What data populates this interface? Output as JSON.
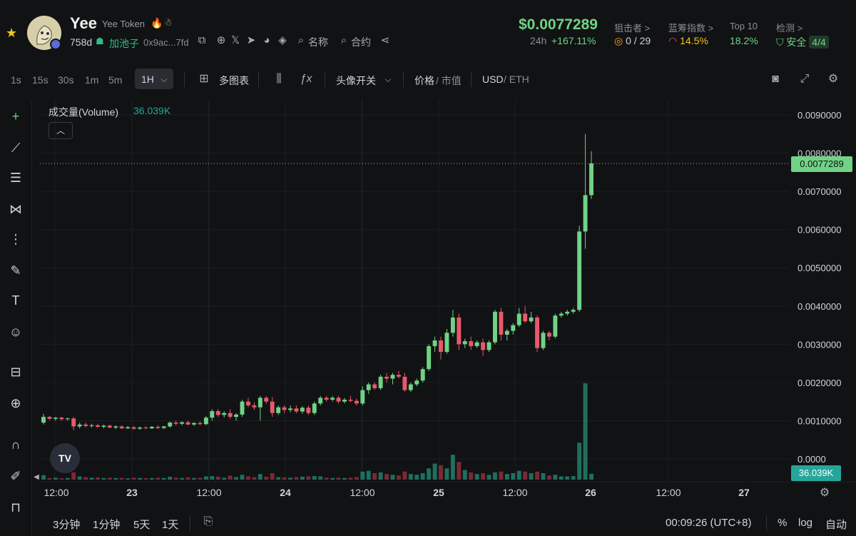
{
  "token": {
    "symbol": "Yee",
    "name": "Yee Token",
    "age": "758d",
    "pool_label": "加池子",
    "address": "0x9ac...7fd",
    "links": {
      "name": "名称",
      "contract": "合约"
    }
  },
  "market": {
    "price": "$0.0077289",
    "change_label": "24h",
    "change": "+167.11%"
  },
  "stats": [
    {
      "title": "狙击者 >",
      "value": "0 / 29",
      "color": "#d1d4dc"
    },
    {
      "title": "蓝筹指数 >",
      "value": "14.5%",
      "color": "#f5c518"
    },
    {
      "title": "Top 10",
      "value": "18.2%",
      "color": "#6fd385"
    },
    {
      "title": "检测 >",
      "value": "安全",
      "badge": "4/4",
      "color": "#6fd385"
    }
  ],
  "toolbar": {
    "timeframes": [
      "1s",
      "15s",
      "30s",
      "1m",
      "5m"
    ],
    "active_timeframe": "1H",
    "multi_chart": "多图表",
    "avatar_toggle": "头像开关",
    "price_label": "价格",
    "mcap_label": "市值",
    "usd_label": "USD",
    "eth_label": "ETH"
  },
  "legend": {
    "volume_label": "成交量(Volume)",
    "volume_value": "36.039K"
  },
  "tags": {
    "price": "0.0077289",
    "volume": "36.039K"
  },
  "bottom": {
    "ranges": [
      "3分钟",
      "1分钟",
      "5天",
      "1天"
    ],
    "clock": "00:09:26 (UTC+8)",
    "percent": "%",
    "log": "log",
    "auto": "自动"
  },
  "colors": {
    "up": "#6fd385",
    "down": "#e8596b",
    "vol_up": "#1f6f5e",
    "vol_down": "#7a2a35",
    "accent": "#6fd385"
  },
  "chart_data": {
    "type": "candlestick",
    "y_ticks": [
      "0.0090000",
      "0.0080000",
      "0.0070000",
      "0.0060000",
      "0.0050000",
      "0.0040000",
      "0.0030000",
      "0.0020000",
      "0.0010000",
      "0.0000"
    ],
    "ylim": [
      0,
      0.0095
    ],
    "x_ticks": [
      "12:00",
      "23",
      "12:00",
      "24",
      "12:00",
      "25",
      "12:00",
      "26",
      "12:00",
      "27"
    ],
    "last_price": 0.0077289,
    "volume_last": "36.039K",
    "series": [
      {
        "o": 0.00095,
        "h": 0.00118,
        "l": 0.0009,
        "c": 0.0011,
        "v": 0.28
      },
      {
        "o": 0.0011,
        "h": 0.00112,
        "l": 0.00102,
        "c": 0.00105,
        "v": 0.1
      },
      {
        "o": 0.00105,
        "h": 0.0011,
        "l": 0.001,
        "c": 0.00108,
        "v": 0.12
      },
      {
        "o": 0.00108,
        "h": 0.0011,
        "l": 0.001,
        "c": 0.00104,
        "v": 0.08
      },
      {
        "o": 0.00104,
        "h": 0.00108,
        "l": 0.001,
        "c": 0.00106,
        "v": 0.1
      },
      {
        "o": 0.00106,
        "h": 0.0011,
        "l": 0.00075,
        "c": 0.00085,
        "v": 0.45
      },
      {
        "o": 0.00085,
        "h": 0.00095,
        "l": 0.0008,
        "c": 0.0009,
        "v": 0.2
      },
      {
        "o": 0.0009,
        "h": 0.00095,
        "l": 0.00082,
        "c": 0.00086,
        "v": 0.15
      },
      {
        "o": 0.00086,
        "h": 0.00092,
        "l": 0.00082,
        "c": 0.00088,
        "v": 0.12
      },
      {
        "o": 0.00088,
        "h": 0.00092,
        "l": 0.00082,
        "c": 0.00084,
        "v": 0.14
      },
      {
        "o": 0.00084,
        "h": 0.0009,
        "l": 0.0008,
        "c": 0.00087,
        "v": 0.1
      },
      {
        "o": 0.00087,
        "h": 0.0009,
        "l": 0.0008,
        "c": 0.00082,
        "v": 0.12
      },
      {
        "o": 0.00082,
        "h": 0.00088,
        "l": 0.00078,
        "c": 0.00085,
        "v": 0.1
      },
      {
        "o": 0.00085,
        "h": 0.00088,
        "l": 0.00078,
        "c": 0.0008,
        "v": 0.11
      },
      {
        "o": 0.0008,
        "h": 0.00086,
        "l": 0.00078,
        "c": 0.00083,
        "v": 0.08
      },
      {
        "o": 0.00083,
        "h": 0.00086,
        "l": 0.00076,
        "c": 0.00079,
        "v": 0.12
      },
      {
        "o": 0.00079,
        "h": 0.00085,
        "l": 0.00076,
        "c": 0.00082,
        "v": 0.1
      },
      {
        "o": 0.00082,
        "h": 0.00086,
        "l": 0.00078,
        "c": 0.0008,
        "v": 0.09
      },
      {
        "o": 0.0008,
        "h": 0.00086,
        "l": 0.00078,
        "c": 0.00084,
        "v": 0.1
      },
      {
        "o": 0.00084,
        "h": 0.00088,
        "l": 0.00078,
        "c": 0.00081,
        "v": 0.12
      },
      {
        "o": 0.00081,
        "h": 0.00086,
        "l": 0.00078,
        "c": 0.00085,
        "v": 0.1
      },
      {
        "o": 0.00085,
        "h": 0.00098,
        "l": 0.00082,
        "c": 0.00095,
        "v": 0.18
      },
      {
        "o": 0.00095,
        "h": 0.001,
        "l": 0.00088,
        "c": 0.00092,
        "v": 0.12
      },
      {
        "o": 0.00092,
        "h": 0.00098,
        "l": 0.00088,
        "c": 0.00096,
        "v": 0.1
      },
      {
        "o": 0.00096,
        "h": 0.001,
        "l": 0.00088,
        "c": 0.0009,
        "v": 0.14
      },
      {
        "o": 0.0009,
        "h": 0.00096,
        "l": 0.00086,
        "c": 0.00094,
        "v": 0.1
      },
      {
        "o": 0.00094,
        "h": 0.00098,
        "l": 0.00088,
        "c": 0.00091,
        "v": 0.11
      },
      {
        "o": 0.00091,
        "h": 0.00112,
        "l": 0.00088,
        "c": 0.00108,
        "v": 0.2
      },
      {
        "o": 0.00108,
        "h": 0.0013,
        "l": 0.001,
        "c": 0.00125,
        "v": 0.22
      },
      {
        "o": 0.00125,
        "h": 0.0013,
        "l": 0.0011,
        "c": 0.00115,
        "v": 0.18
      },
      {
        "o": 0.00115,
        "h": 0.00125,
        "l": 0.00108,
        "c": 0.0012,
        "v": 0.12
      },
      {
        "o": 0.0012,
        "h": 0.0013,
        "l": 0.00105,
        "c": 0.0011,
        "v": 0.25
      },
      {
        "o": 0.0011,
        "h": 0.0012,
        "l": 0.001,
        "c": 0.00116,
        "v": 0.16
      },
      {
        "o": 0.00116,
        "h": 0.00155,
        "l": 0.0011,
        "c": 0.0015,
        "v": 0.3
      },
      {
        "o": 0.0015,
        "h": 0.0016,
        "l": 0.00135,
        "c": 0.0014,
        "v": 0.2
      },
      {
        "o": 0.0014,
        "h": 0.00148,
        "l": 0.00128,
        "c": 0.00135,
        "v": 0.15
      },
      {
        "o": 0.00135,
        "h": 0.00165,
        "l": 0.001,
        "c": 0.0016,
        "v": 0.35
      },
      {
        "o": 0.0016,
        "h": 0.00165,
        "l": 0.00145,
        "c": 0.0015,
        "v": 0.18
      },
      {
        "o": 0.0015,
        "h": 0.00162,
        "l": 0.0011,
        "c": 0.0012,
        "v": 0.4
      },
      {
        "o": 0.0012,
        "h": 0.0014,
        "l": 0.00115,
        "c": 0.00135,
        "v": 0.15
      },
      {
        "o": 0.00135,
        "h": 0.0014,
        "l": 0.0012,
        "c": 0.00128,
        "v": 0.14
      },
      {
        "o": 0.00128,
        "h": 0.0014,
        "l": 0.00122,
        "c": 0.00132,
        "v": 0.12
      },
      {
        "o": 0.00132,
        "h": 0.0014,
        "l": 0.0012,
        "c": 0.00124,
        "v": 0.15
      },
      {
        "o": 0.00124,
        "h": 0.00138,
        "l": 0.00118,
        "c": 0.00134,
        "v": 0.18
      },
      {
        "o": 0.00134,
        "h": 0.0014,
        "l": 0.00115,
        "c": 0.0012,
        "v": 0.2
      },
      {
        "o": 0.0012,
        "h": 0.0015,
        "l": 0.00115,
        "c": 0.00145,
        "v": 0.22
      },
      {
        "o": 0.00145,
        "h": 0.00165,
        "l": 0.0014,
        "c": 0.0016,
        "v": 0.2
      },
      {
        "o": 0.0016,
        "h": 0.00165,
        "l": 0.0015,
        "c": 0.00155,
        "v": 0.12
      },
      {
        "o": 0.00155,
        "h": 0.00165,
        "l": 0.0015,
        "c": 0.0016,
        "v": 0.1
      },
      {
        "o": 0.0016,
        "h": 0.00165,
        "l": 0.00145,
        "c": 0.0015,
        "v": 0.12
      },
      {
        "o": 0.0015,
        "h": 0.0016,
        "l": 0.00145,
        "c": 0.00155,
        "v": 0.1
      },
      {
        "o": 0.00155,
        "h": 0.00165,
        "l": 0.00148,
        "c": 0.00152,
        "v": 0.12
      },
      {
        "o": 0.00152,
        "h": 0.00158,
        "l": 0.0014,
        "c": 0.00145,
        "v": 0.15
      },
      {
        "o": 0.00145,
        "h": 0.0019,
        "l": 0.0014,
        "c": 0.0018,
        "v": 0.5
      },
      {
        "o": 0.0018,
        "h": 0.002,
        "l": 0.0017,
        "c": 0.00195,
        "v": 0.55
      },
      {
        "o": 0.00195,
        "h": 0.002,
        "l": 0.0018,
        "c": 0.00185,
        "v": 0.4
      },
      {
        "o": 0.00185,
        "h": 0.0022,
        "l": 0.0018,
        "c": 0.00215,
        "v": 0.45
      },
      {
        "o": 0.00215,
        "h": 0.00225,
        "l": 0.002,
        "c": 0.0021,
        "v": 0.35
      },
      {
        "o": 0.0021,
        "h": 0.00225,
        "l": 0.00195,
        "c": 0.0022,
        "v": 0.3
      },
      {
        "o": 0.0022,
        "h": 0.0023,
        "l": 0.0021,
        "c": 0.00215,
        "v": 0.25
      },
      {
        "o": 0.00215,
        "h": 0.00225,
        "l": 0.00175,
        "c": 0.0018,
        "v": 0.5
      },
      {
        "o": 0.0018,
        "h": 0.002,
        "l": 0.00175,
        "c": 0.00195,
        "v": 0.35
      },
      {
        "o": 0.00195,
        "h": 0.0021,
        "l": 0.0019,
        "c": 0.00205,
        "v": 0.3
      },
      {
        "o": 0.00205,
        "h": 0.0024,
        "l": 0.002,
        "c": 0.00235,
        "v": 0.4
      },
      {
        "o": 0.00235,
        "h": 0.003,
        "l": 0.0023,
        "c": 0.00295,
        "v": 0.7
      },
      {
        "o": 0.00295,
        "h": 0.0032,
        "l": 0.0028,
        "c": 0.0031,
        "v": 1.0
      },
      {
        "o": 0.0031,
        "h": 0.0032,
        "l": 0.0026,
        "c": 0.0028,
        "v": 0.9
      },
      {
        "o": 0.0028,
        "h": 0.0034,
        "l": 0.00275,
        "c": 0.0033,
        "v": 0.7
      },
      {
        "o": 0.0033,
        "h": 0.0039,
        "l": 0.0032,
        "c": 0.0037,
        "v": 1.55
      },
      {
        "o": 0.0037,
        "h": 0.0038,
        "l": 0.00285,
        "c": 0.003,
        "v": 1.1
      },
      {
        "o": 0.003,
        "h": 0.00315,
        "l": 0.0029,
        "c": 0.00308,
        "v": 0.6
      },
      {
        "o": 0.00308,
        "h": 0.0032,
        "l": 0.00285,
        "c": 0.00295,
        "v": 0.45
      },
      {
        "o": 0.00295,
        "h": 0.0031,
        "l": 0.0029,
        "c": 0.00305,
        "v": 0.35
      },
      {
        "o": 0.00305,
        "h": 0.00315,
        "l": 0.0027,
        "c": 0.00285,
        "v": 0.4
      },
      {
        "o": 0.00285,
        "h": 0.0031,
        "l": 0.0028,
        "c": 0.00305,
        "v": 0.3
      },
      {
        "o": 0.00305,
        "h": 0.0039,
        "l": 0.003,
        "c": 0.00385,
        "v": 0.45
      },
      {
        "o": 0.00385,
        "h": 0.00395,
        "l": 0.0031,
        "c": 0.00325,
        "v": 0.5
      },
      {
        "o": 0.00325,
        "h": 0.0034,
        "l": 0.0031,
        "c": 0.00335,
        "v": 0.35
      },
      {
        "o": 0.00335,
        "h": 0.00355,
        "l": 0.00325,
        "c": 0.0035,
        "v": 0.4
      },
      {
        "o": 0.0035,
        "h": 0.00395,
        "l": 0.00345,
        "c": 0.0038,
        "v": 0.55
      },
      {
        "o": 0.0038,
        "h": 0.004,
        "l": 0.00355,
        "c": 0.0036,
        "v": 0.5
      },
      {
        "o": 0.0036,
        "h": 0.00385,
        "l": 0.00355,
        "c": 0.0037,
        "v": 0.4
      },
      {
        "o": 0.0037,
        "h": 0.00375,
        "l": 0.0028,
        "c": 0.0029,
        "v": 0.5
      },
      {
        "o": 0.0029,
        "h": 0.00335,
        "l": 0.00285,
        "c": 0.0033,
        "v": 0.4
      },
      {
        "o": 0.0033,
        "h": 0.00335,
        "l": 0.0031,
        "c": 0.0032,
        "v": 0.25
      },
      {
        "o": 0.0032,
        "h": 0.0038,
        "l": 0.00315,
        "c": 0.00375,
        "v": 0.3
      },
      {
        "o": 0.00375,
        "h": 0.00385,
        "l": 0.0037,
        "c": 0.0038,
        "v": 0.2
      },
      {
        "o": 0.0038,
        "h": 0.0039,
        "l": 0.00375,
        "c": 0.00385,
        "v": 0.2
      },
      {
        "o": 0.00385,
        "h": 0.00395,
        "l": 0.0038,
        "c": 0.0039,
        "v": 0.22
      },
      {
        "o": 0.0039,
        "h": 0.0061,
        "l": 0.00385,
        "c": 0.00595,
        "v": 2.3
      },
      {
        "o": 0.00595,
        "h": 0.0085,
        "l": 0.0055,
        "c": 0.0069,
        "v": 6.0
      },
      {
        "o": 0.0069,
        "h": 0.00805,
        "l": 0.0068,
        "c": 0.00773,
        "v": 0.36
      }
    ]
  }
}
